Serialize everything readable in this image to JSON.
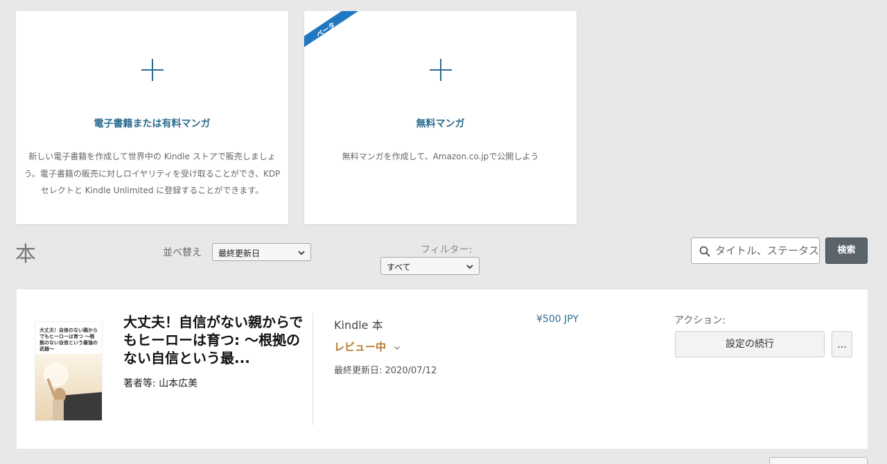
{
  "create_cards": [
    {
      "title": "電子書籍または有料マンガ",
      "description": "新しい電子書籍を作成して世界中の Kindle ストアで販売しましょう。電子書籍の販売に対しロイヤリティを受け取ることができ、KDP セレクトと Kindle Unlimited に登録することができます。"
    },
    {
      "badge": "ベータ",
      "title": "無料マンガ",
      "description": "無料マンガを作成して、Amazon.co.jpで公開しよう"
    }
  ],
  "colors": {
    "accent_link": "#2a6b8f",
    "beta_ribbon": "#1f78c1",
    "status_review": "#b57a2a",
    "search_button": "#5b636b"
  },
  "bookshelf": {
    "section_title": "本",
    "sort": {
      "label": "並べ替え",
      "selected": "最終更新日"
    },
    "filter": {
      "label": "フィルター:",
      "selected": "すべて"
    },
    "search": {
      "placeholder": "タイトル、ステータス",
      "button_label": "検索"
    }
  },
  "books": [
    {
      "cover_text": "大丈夫！自信のない親からでもヒーローは育つ ～根拠のない自信という最強の武器～",
      "title": "大丈夫！自信がない親からでもヒーローは育つ: ～根拠のない自信という最...",
      "author": "著者等: 山本広美",
      "format": "Kindle 本",
      "status": "レビュー中",
      "last_updated": "最終更新日: 2020/07/12",
      "price": "¥500 JPY",
      "actions_label": "アクション:",
      "continue_label": "設定の続行",
      "more_label": "..."
    }
  ]
}
